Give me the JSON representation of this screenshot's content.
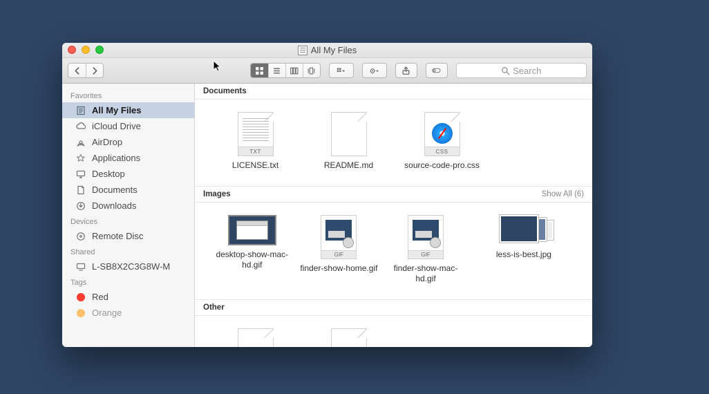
{
  "window": {
    "title": "All My Files"
  },
  "search": {
    "placeholder": "Search"
  },
  "sidebar": {
    "sections": [
      {
        "header": "Favorites",
        "items": [
          {
            "label": "All My Files",
            "icon": "all-my-files",
            "selected": true
          },
          {
            "label": "iCloud Drive",
            "icon": "cloud"
          },
          {
            "label": "AirDrop",
            "icon": "airdrop"
          },
          {
            "label": "Applications",
            "icon": "applications"
          },
          {
            "label": "Desktop",
            "icon": "desktop"
          },
          {
            "label": "Documents",
            "icon": "documents"
          },
          {
            "label": "Downloads",
            "icon": "downloads"
          }
        ]
      },
      {
        "header": "Devices",
        "items": [
          {
            "label": "Remote Disc",
            "icon": "disc"
          }
        ]
      },
      {
        "header": "Shared",
        "items": [
          {
            "label": "L-SB8X2C3G8W-M",
            "icon": "monitor"
          }
        ]
      },
      {
        "header": "Tags",
        "items": [
          {
            "label": "Red",
            "icon": "tag",
            "color": "#ff3b30"
          },
          {
            "label": "Orange",
            "icon": "tag",
            "color": "#ff9500"
          }
        ]
      }
    ]
  },
  "sections": [
    {
      "name": "Documents",
      "items": [
        {
          "label": "LICENSE.txt",
          "kind": "txt"
        },
        {
          "label": "README.md",
          "kind": "blank"
        },
        {
          "label": "source-code-pro.css",
          "kind": "css"
        }
      ]
    },
    {
      "name": "Images",
      "show_all": "Show All (6)",
      "items": [
        {
          "label": "desktop-show-mac-hd.gif",
          "kind": "thumb-window"
        },
        {
          "label": "finder-show-home.gif",
          "kind": "gif"
        },
        {
          "label": "finder-show-mac-hd.gif",
          "kind": "gif"
        },
        {
          "label": "less-is-best.jpg",
          "kind": "thumb-stack"
        }
      ]
    },
    {
      "name": "Other",
      "items": [
        {
          "label": "",
          "kind": "blank"
        },
        {
          "label": "",
          "kind": "blank"
        }
      ]
    }
  ]
}
